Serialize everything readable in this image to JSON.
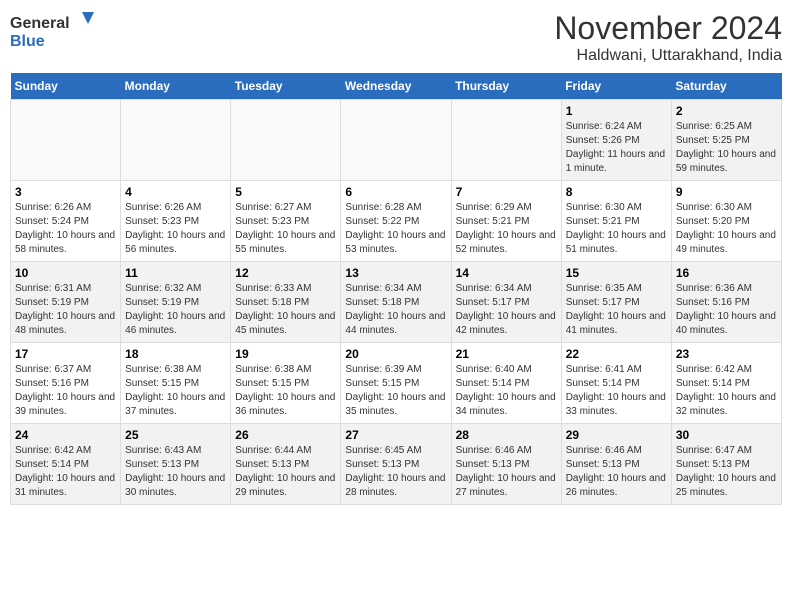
{
  "logo": {
    "line1": "General",
    "line2": "Blue"
  },
  "title": "November 2024",
  "location": "Haldwani, Uttarakhand, India",
  "weekdays": [
    "Sunday",
    "Monday",
    "Tuesday",
    "Wednesday",
    "Thursday",
    "Friday",
    "Saturday"
  ],
  "weeks": [
    [
      {
        "day": "",
        "info": ""
      },
      {
        "day": "",
        "info": ""
      },
      {
        "day": "",
        "info": ""
      },
      {
        "day": "",
        "info": ""
      },
      {
        "day": "",
        "info": ""
      },
      {
        "day": "1",
        "info": "Sunrise: 6:24 AM\nSunset: 5:26 PM\nDaylight: 11 hours and 1 minute."
      },
      {
        "day": "2",
        "info": "Sunrise: 6:25 AM\nSunset: 5:25 PM\nDaylight: 10 hours and 59 minutes."
      }
    ],
    [
      {
        "day": "3",
        "info": "Sunrise: 6:26 AM\nSunset: 5:24 PM\nDaylight: 10 hours and 58 minutes."
      },
      {
        "day": "4",
        "info": "Sunrise: 6:26 AM\nSunset: 5:23 PM\nDaylight: 10 hours and 56 minutes."
      },
      {
        "day": "5",
        "info": "Sunrise: 6:27 AM\nSunset: 5:23 PM\nDaylight: 10 hours and 55 minutes."
      },
      {
        "day": "6",
        "info": "Sunrise: 6:28 AM\nSunset: 5:22 PM\nDaylight: 10 hours and 53 minutes."
      },
      {
        "day": "7",
        "info": "Sunrise: 6:29 AM\nSunset: 5:21 PM\nDaylight: 10 hours and 52 minutes."
      },
      {
        "day": "8",
        "info": "Sunrise: 6:30 AM\nSunset: 5:21 PM\nDaylight: 10 hours and 51 minutes."
      },
      {
        "day": "9",
        "info": "Sunrise: 6:30 AM\nSunset: 5:20 PM\nDaylight: 10 hours and 49 minutes."
      }
    ],
    [
      {
        "day": "10",
        "info": "Sunrise: 6:31 AM\nSunset: 5:19 PM\nDaylight: 10 hours and 48 minutes."
      },
      {
        "day": "11",
        "info": "Sunrise: 6:32 AM\nSunset: 5:19 PM\nDaylight: 10 hours and 46 minutes."
      },
      {
        "day": "12",
        "info": "Sunrise: 6:33 AM\nSunset: 5:18 PM\nDaylight: 10 hours and 45 minutes."
      },
      {
        "day": "13",
        "info": "Sunrise: 6:34 AM\nSunset: 5:18 PM\nDaylight: 10 hours and 44 minutes."
      },
      {
        "day": "14",
        "info": "Sunrise: 6:34 AM\nSunset: 5:17 PM\nDaylight: 10 hours and 42 minutes."
      },
      {
        "day": "15",
        "info": "Sunrise: 6:35 AM\nSunset: 5:17 PM\nDaylight: 10 hours and 41 minutes."
      },
      {
        "day": "16",
        "info": "Sunrise: 6:36 AM\nSunset: 5:16 PM\nDaylight: 10 hours and 40 minutes."
      }
    ],
    [
      {
        "day": "17",
        "info": "Sunrise: 6:37 AM\nSunset: 5:16 PM\nDaylight: 10 hours and 39 minutes."
      },
      {
        "day": "18",
        "info": "Sunrise: 6:38 AM\nSunset: 5:15 PM\nDaylight: 10 hours and 37 minutes."
      },
      {
        "day": "19",
        "info": "Sunrise: 6:38 AM\nSunset: 5:15 PM\nDaylight: 10 hours and 36 minutes."
      },
      {
        "day": "20",
        "info": "Sunrise: 6:39 AM\nSunset: 5:15 PM\nDaylight: 10 hours and 35 minutes."
      },
      {
        "day": "21",
        "info": "Sunrise: 6:40 AM\nSunset: 5:14 PM\nDaylight: 10 hours and 34 minutes."
      },
      {
        "day": "22",
        "info": "Sunrise: 6:41 AM\nSunset: 5:14 PM\nDaylight: 10 hours and 33 minutes."
      },
      {
        "day": "23",
        "info": "Sunrise: 6:42 AM\nSunset: 5:14 PM\nDaylight: 10 hours and 32 minutes."
      }
    ],
    [
      {
        "day": "24",
        "info": "Sunrise: 6:42 AM\nSunset: 5:14 PM\nDaylight: 10 hours and 31 minutes."
      },
      {
        "day": "25",
        "info": "Sunrise: 6:43 AM\nSunset: 5:13 PM\nDaylight: 10 hours and 30 minutes."
      },
      {
        "day": "26",
        "info": "Sunrise: 6:44 AM\nSunset: 5:13 PM\nDaylight: 10 hours and 29 minutes."
      },
      {
        "day": "27",
        "info": "Sunrise: 6:45 AM\nSunset: 5:13 PM\nDaylight: 10 hours and 28 minutes."
      },
      {
        "day": "28",
        "info": "Sunrise: 6:46 AM\nSunset: 5:13 PM\nDaylight: 10 hours and 27 minutes."
      },
      {
        "day": "29",
        "info": "Sunrise: 6:46 AM\nSunset: 5:13 PM\nDaylight: 10 hours and 26 minutes."
      },
      {
        "day": "30",
        "info": "Sunrise: 6:47 AM\nSunset: 5:13 PM\nDaylight: 10 hours and 25 minutes."
      }
    ]
  ]
}
